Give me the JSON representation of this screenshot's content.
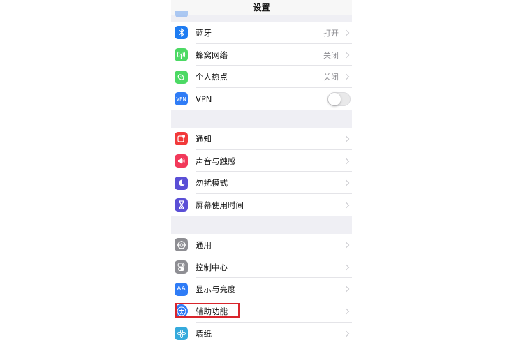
{
  "nav": {
    "title": "设置"
  },
  "groups": [
    {
      "rows": [
        {
          "label": "蓝牙",
          "value": "打开",
          "icon": "bluetooth-icon",
          "color": "#1e7cf2"
        },
        {
          "label": "蜂窝网络",
          "value": "关闭",
          "icon": "cellular-icon",
          "color": "#4cd964"
        },
        {
          "label": "个人热点",
          "value": "关闭",
          "icon": "hotspot-icon",
          "color": "#4cd964"
        },
        {
          "label": "VPN",
          "icon": "vpn-icon",
          "icon_text": "VPN",
          "color": "#2f7cf6",
          "toggle": false
        }
      ]
    },
    {
      "rows": [
        {
          "label": "通知",
          "icon": "notifications-icon",
          "color": "#f2393a"
        },
        {
          "label": "声音与触感",
          "icon": "sound-icon",
          "color": "#f2395a"
        },
        {
          "label": "勿扰模式",
          "icon": "moon-icon",
          "color": "#5a4fd6"
        },
        {
          "label": "屏幕使用时间",
          "icon": "hourglass-icon",
          "color": "#5a4fd6"
        }
      ]
    },
    {
      "rows": [
        {
          "label": "通用",
          "icon": "gear-icon",
          "color": "#8e8e93"
        },
        {
          "label": "控制中心",
          "icon": "control-center-icon",
          "color": "#8e8e93"
        },
        {
          "label": "显示与亮度",
          "icon": "display-icon",
          "icon_text": "AA",
          "color": "#2f7cf6"
        },
        {
          "label": "辅助功能",
          "icon": "accessibility-icon",
          "color": "#2f7cf6"
        },
        {
          "label": "墙纸",
          "icon": "wallpaper-icon",
          "color": "#35aadc"
        }
      ]
    }
  ],
  "highlight_color": "#d9252c"
}
